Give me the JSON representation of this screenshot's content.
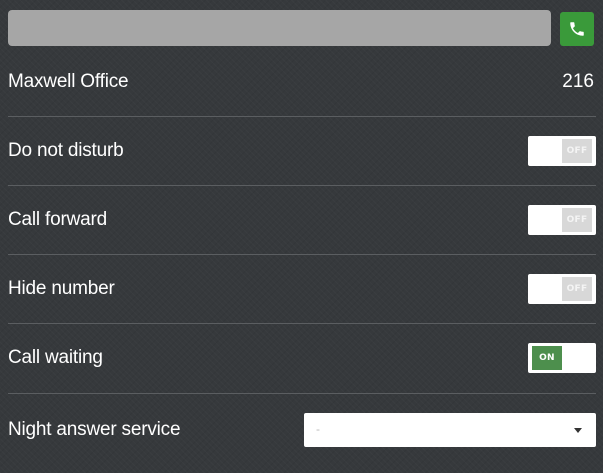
{
  "dialer": {
    "input_value": "",
    "call_icon": "phone-icon",
    "call_color": "#3a9a3a"
  },
  "line": {
    "name": "Maxwell Office",
    "extension": "216"
  },
  "settings": [
    {
      "label": "Do not disturb",
      "state": "OFF",
      "on": false
    },
    {
      "label": "Call forward",
      "state": "OFF",
      "on": false
    },
    {
      "label": "Hide number",
      "state": "OFF",
      "on": false
    },
    {
      "label": "Call waiting",
      "state": "ON",
      "on": true
    }
  ],
  "night_answer": {
    "label": "Night answer service",
    "selected": "-"
  },
  "colors": {
    "background": "#36393c",
    "toggle_on": "#4d8f4d",
    "separator": "#5b5e61"
  }
}
